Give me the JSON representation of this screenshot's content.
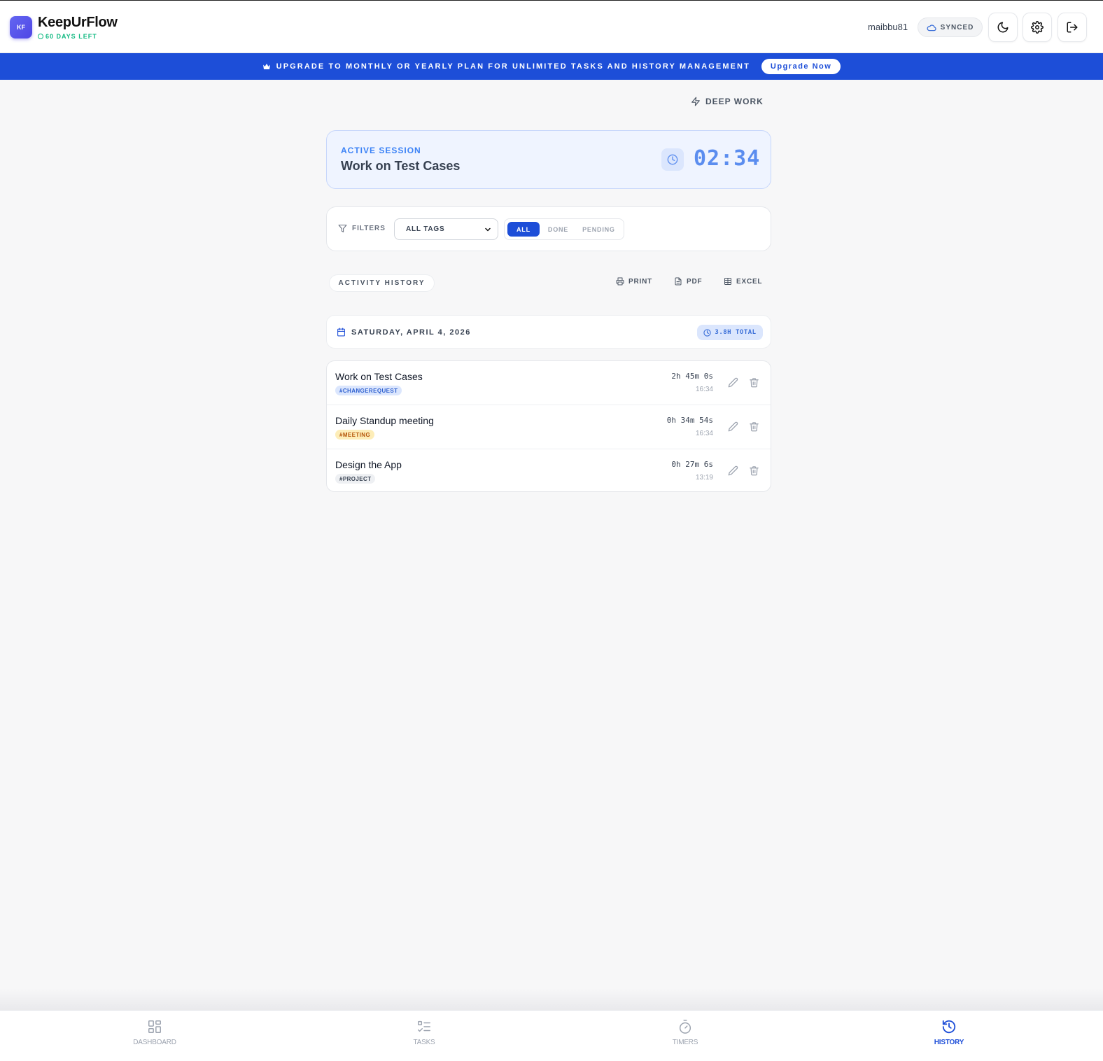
{
  "header": {
    "logo_text": "KF",
    "brand": "KeepUrFlow",
    "days_left": "60 DAYS LEFT",
    "username": "maibbu81",
    "sync_status": "SYNCED"
  },
  "banner": {
    "text": "UPGRADE TO MONTHLY OR YEARLY PLAN FOR UNLIMITED TASKS AND HISTORY MANAGEMENT",
    "button_label": "Upgrade Now"
  },
  "mode": {
    "label": "DEEP WORK"
  },
  "session": {
    "label": "ACTIVE SESSION",
    "title": "Work on Test Cases",
    "timer": "02:34"
  },
  "filters": {
    "label": "FILTERS",
    "tag_select": "ALL TAGS",
    "status_options": [
      "ALL",
      "DONE",
      "PENDING"
    ],
    "active_status": "ALL"
  },
  "history": {
    "heading": "ACTIVITY HISTORY",
    "exports": {
      "print": "PRINT",
      "pdf": "PDF",
      "excel": "EXCEL"
    },
    "date": "SATURDAY, APRIL 4, 2026",
    "total": "3.8H TOTAL",
    "entries": [
      {
        "title": "Work on Test Cases",
        "tag": "#CHANGEREQUEST",
        "tag_color": "#dbe6fd",
        "duration": "2h 45m 0s",
        "time": "16:34"
      },
      {
        "title": "Daily Standup meeting",
        "tag": "#MEETING",
        "tag_color": "#fdedb8",
        "duration": "0h 34m 54s",
        "time": "16:34"
      },
      {
        "title": "Design the App",
        "tag": "#PROJECT",
        "tag_color": "#eef0f3",
        "duration": "0h 27m 6s",
        "time": "13:19"
      }
    ]
  },
  "nav": {
    "items": [
      {
        "label": "DASHBOARD",
        "icon": "grid-icon"
      },
      {
        "label": "TASKS",
        "icon": "checklist-icon"
      },
      {
        "label": "TIMERS",
        "icon": "stopwatch-icon"
      },
      {
        "label": "HISTORY",
        "icon": "history-icon"
      }
    ],
    "active": "HISTORY"
  },
  "colors": {
    "primary": "#1d4ed8",
    "accent_green": "#10b981",
    "session_bg": "#eff4ff"
  }
}
